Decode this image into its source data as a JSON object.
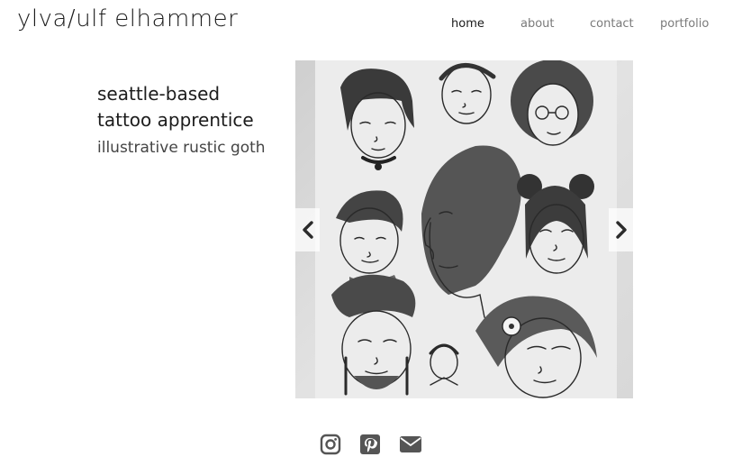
{
  "site": {
    "title": "ylva/ulf elhammer"
  },
  "nav": [
    {
      "label": "home",
      "active": true
    },
    {
      "label": "about",
      "active": false
    },
    {
      "label": "contact",
      "active": false
    },
    {
      "label": "portfolio",
      "active": false
    }
  ],
  "hero": {
    "headline": "seattle-based tattoo apprentice",
    "subline": "illustrative rustic goth"
  },
  "slider": {
    "image_subject": "black-ink sketch sheet of illustrated faces",
    "prev_icon": "chevron-left-icon",
    "next_icon": "chevron-right-icon"
  },
  "social": [
    {
      "icon": "instagram-icon"
    },
    {
      "icon": "pinterest-icon"
    },
    {
      "icon": "envelope-icon"
    }
  ],
  "colors": {
    "text": "#1c1c1c",
    "nav_inactive": "#7a7a7a",
    "icon": "#555555"
  }
}
